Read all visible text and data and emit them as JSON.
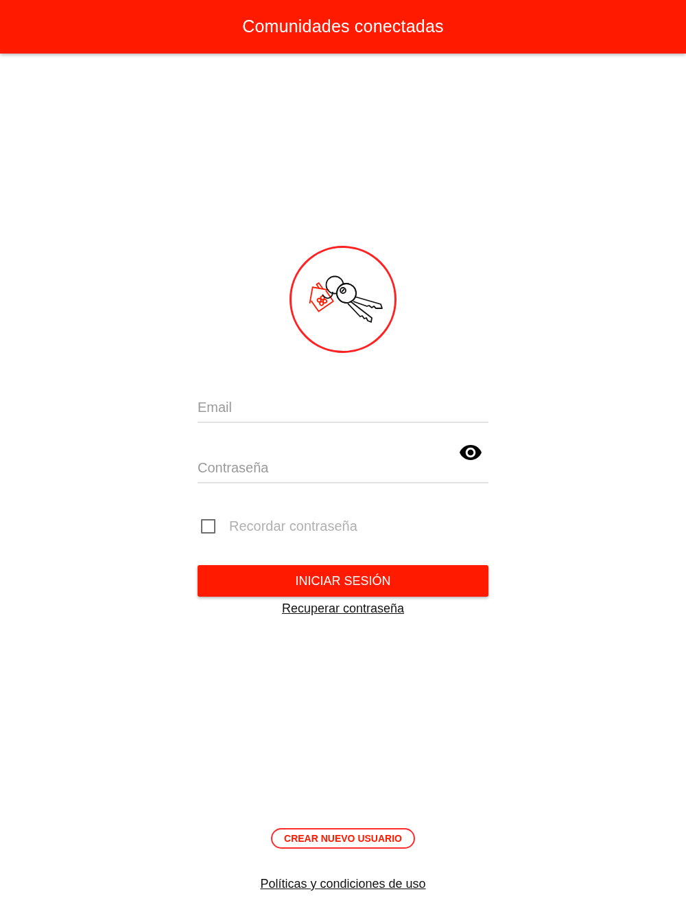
{
  "app_bar": {
    "title": "Comunidades conectadas"
  },
  "login_form": {
    "email": {
      "placeholder": "Email"
    },
    "password": {
      "placeholder": "Contraseña"
    },
    "remember": {
      "label": "Recordar contraseña",
      "checked": false
    },
    "submit": "INICIAR SESIÓN",
    "recover_link": "Recuperar contraseña"
  },
  "footer": {
    "create_user": "CREAR NUEVO USUARIO",
    "policies_link": "Políticas y condiciones de uso"
  }
}
